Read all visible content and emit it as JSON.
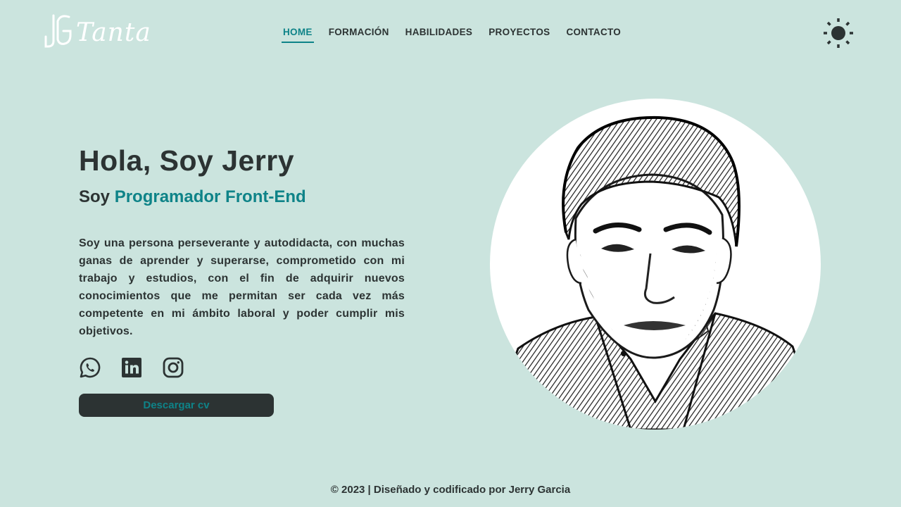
{
  "header": {
    "logo_text": "Tanta",
    "logo_icon": "jg-monogram-icon",
    "theme_icon": "sun-icon"
  },
  "nav": {
    "items": [
      {
        "label": "HOME",
        "active": true
      },
      {
        "label": "FORMACIÓN",
        "active": false
      },
      {
        "label": "HABILIDADES",
        "active": false
      },
      {
        "label": "PROYECTOS",
        "active": false
      },
      {
        "label": "CONTACTO",
        "active": false
      }
    ]
  },
  "hero": {
    "title": "Hola, Soy Jerry",
    "subtitle_prefix": "Soy ",
    "subtitle_accent": "Programador Front-End",
    "description": "Soy una persona perseverante y autodidacta, con muchas ganas de aprender y superarse, comprometido con mi trabajo y estudios, con el fin de adquirir nuevos conocimientos que me permitan ser cada vez más competente en mi ámbito laboral y poder cumplir mis objetivos.",
    "socials": [
      "whatsapp-icon",
      "linkedin-icon",
      "instagram-icon"
    ],
    "cv_button": "Descargar cv",
    "portrait": "profile-portrait"
  },
  "footer": {
    "text": "© 2023 | Diseñado y codificado por Jerry Garcia"
  },
  "colors": {
    "background": "#cbe4de",
    "dark": "#2c3333",
    "accent": "#0e8388",
    "white": "#ffffff"
  }
}
